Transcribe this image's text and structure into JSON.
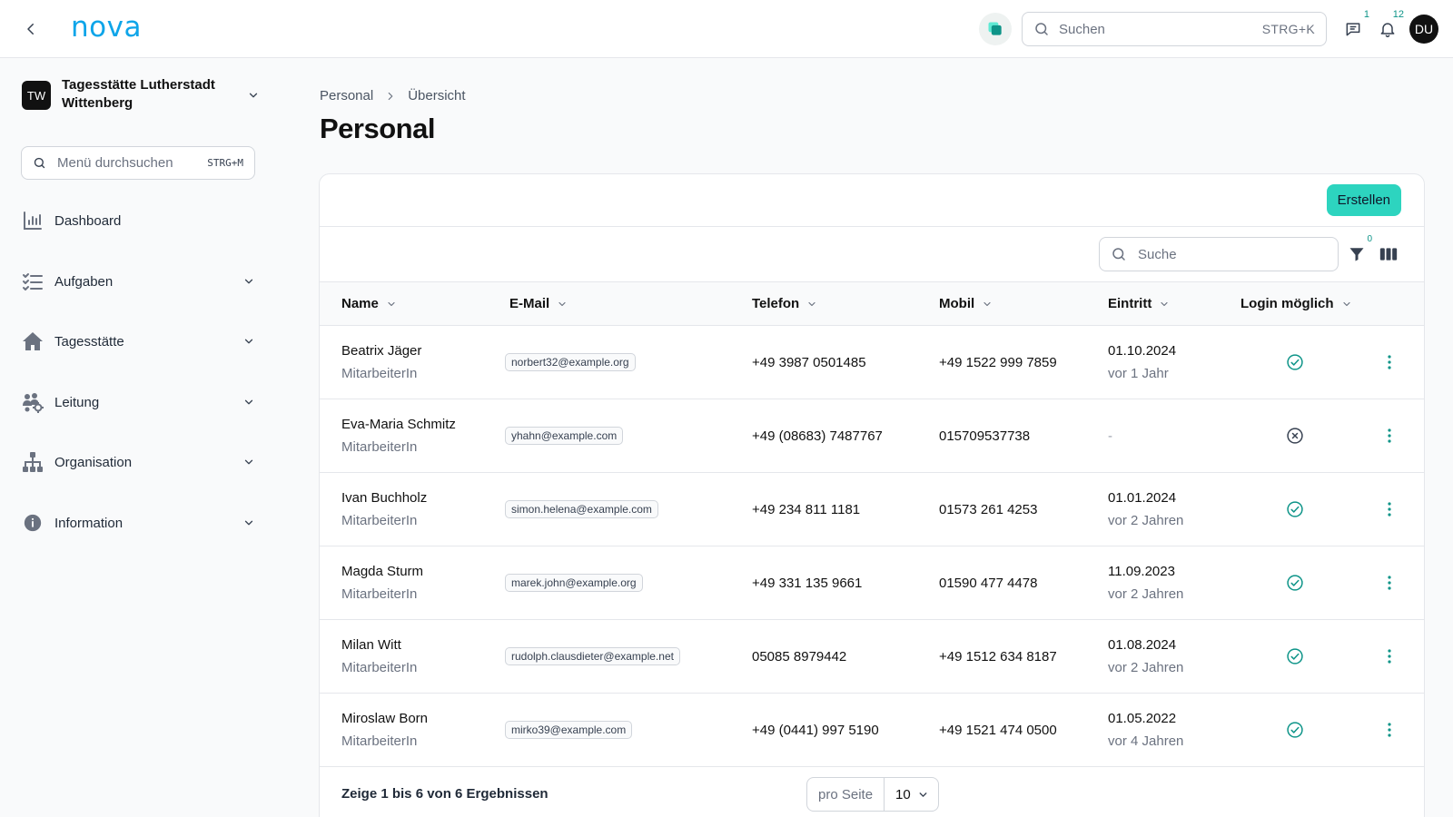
{
  "header": {
    "logo": "nova",
    "search_placeholder": "Suchen",
    "search_shortcut": "STRG+K",
    "messages_count": "1",
    "notifications_count": "12",
    "avatar_initials": "DU"
  },
  "sidebar": {
    "org_initials": "TW",
    "org_name": "Tagesstätte Lutherstadt Wittenberg",
    "menu_search_placeholder": "Menü durchsuchen",
    "menu_search_shortcut": "STRG+M",
    "items": [
      {
        "label": "Dashboard",
        "icon": "bar-chart-icon"
      },
      {
        "label": "Aufgaben",
        "icon": "task-list-icon"
      },
      {
        "label": "Tagesstätte",
        "icon": "home-icon"
      },
      {
        "label": "Leitung",
        "icon": "users-gear-icon"
      },
      {
        "label": "Organisation",
        "icon": "org-chart-icon"
      },
      {
        "label": "Information",
        "icon": "info-icon"
      }
    ]
  },
  "breadcrumb": [
    "Personal",
    "Übersicht"
  ],
  "page_title": "Personal",
  "toolbar": {
    "create_label": "Erstellen",
    "search_placeholder": "Suche",
    "filter_count": "0"
  },
  "table": {
    "columns": [
      "Name",
      "E-Mail",
      "Telefon",
      "Mobil",
      "Eintritt",
      "Login möglich"
    ],
    "rows": [
      {
        "name": "Beatrix Jäger",
        "role": "MitarbeiterIn",
        "email": "norbert32@example.org",
        "phone": "+49 3987 0501485",
        "mobile": "+49 1522 999 7859",
        "entry_date": "01.10.2024",
        "entry_relative": "vor 1 Jahr",
        "login": true
      },
      {
        "name": "Eva-Maria Schmitz",
        "role": "MitarbeiterIn",
        "email": "yhahn@example.com",
        "phone": "+49 (08683) 7487767",
        "mobile": "015709537738",
        "entry_date": "-",
        "entry_relative": "",
        "login": false
      },
      {
        "name": "Ivan Buchholz",
        "role": "MitarbeiterIn",
        "email": "simon.helena@example.com",
        "phone": "+49 234 811 1181",
        "mobile": "01573 261 4253",
        "entry_date": "01.01.2024",
        "entry_relative": "vor 2 Jahren",
        "login": true
      },
      {
        "name": "Magda Sturm",
        "role": "MitarbeiterIn",
        "email": "marek.john@example.org",
        "phone": "+49 331 135 9661",
        "mobile": "01590 477 4478",
        "entry_date": "11.09.2023",
        "entry_relative": "vor 2 Jahren",
        "login": true
      },
      {
        "name": "Milan Witt",
        "role": "MitarbeiterIn",
        "email": "rudolph.clausdieter@example.net",
        "phone": "05085 8979442",
        "mobile": "+49 1512 634 8187",
        "entry_date": "01.08.2024",
        "entry_relative": "vor 2 Jahren",
        "login": true
      },
      {
        "name": "Miroslaw Born",
        "role": "MitarbeiterIn",
        "email": "mirko39@example.com",
        "phone": "+49 (0441) 997 5190",
        "mobile": "+49 1521 474 0500",
        "entry_date": "01.05.2022",
        "entry_relative": "vor 4 Jahren",
        "login": true
      }
    ]
  },
  "footer": {
    "summary": "Zeige 1 bis 6 von 6 Ergebnissen",
    "per_page_label": "pro Seite",
    "per_page_value": "10"
  },
  "colors": {
    "accent": "#2dd4bf",
    "logo": "#0ea5e9",
    "success": "#0d9488",
    "muted": "#6b7280"
  }
}
